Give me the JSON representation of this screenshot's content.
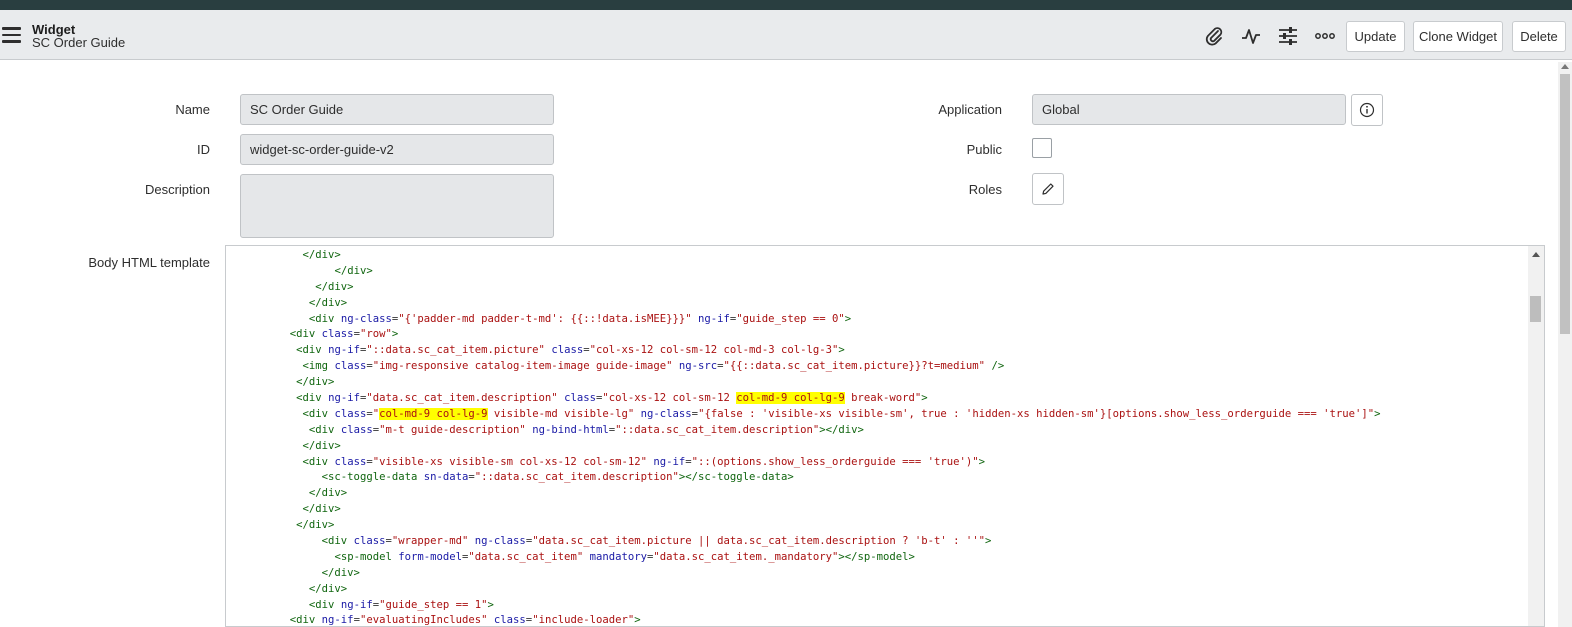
{
  "header": {
    "title": "Widget",
    "subtitle": "SC Order Guide",
    "icons": [
      "paperclip-icon",
      "activity-icon",
      "sliders-icon",
      "more-icon"
    ],
    "buttons": {
      "update": "Update",
      "clone": "Clone Widget",
      "delete": "Delete"
    }
  },
  "form": {
    "name": {
      "label": "Name",
      "value": "SC Order Guide"
    },
    "id": {
      "label": "ID",
      "value": "widget-sc-order-guide-v2"
    },
    "description": {
      "label": "Description",
      "value": ""
    },
    "application": {
      "label": "Application",
      "value": "Global"
    },
    "public": {
      "label": "Public",
      "checked": false
    },
    "roles": {
      "label": "Roles"
    },
    "body_html": {
      "label": "Body HTML template"
    }
  },
  "code_lines": [
    {
      "indent": "            ",
      "segs": [
        [
          "tg",
          "</div>"
        ]
      ]
    },
    {
      "indent": "                 ",
      "segs": [
        [
          "tg",
          "</div>"
        ]
      ]
    },
    {
      "indent": "              ",
      "segs": [
        [
          "tg",
          "</div>"
        ]
      ]
    },
    {
      "indent": "             ",
      "segs": [
        [
          "tg",
          "</div>"
        ]
      ]
    },
    {
      "indent": "             ",
      "segs": [
        [
          "tg",
          "<div "
        ],
        [
          "at",
          "ng-class"
        ],
        [
          "pl",
          "="
        ],
        [
          "st",
          "\"{'padder-md padder-t-md': {{::!data.isMEE}}}\""
        ],
        [
          "pl",
          " "
        ],
        [
          "at",
          "ng-if"
        ],
        [
          "pl",
          "="
        ],
        [
          "st",
          "\"guide_step == 0\""
        ],
        [
          "tg",
          ">"
        ]
      ]
    },
    {
      "indent": "          ",
      "segs": [
        [
          "tg",
          "<div "
        ],
        [
          "at",
          "class"
        ],
        [
          "pl",
          "="
        ],
        [
          "st",
          "\"row\""
        ],
        [
          "tg",
          ">"
        ]
      ]
    },
    {
      "indent": "           ",
      "segs": [
        [
          "tg",
          "<div "
        ],
        [
          "at",
          "ng-if"
        ],
        [
          "pl",
          "="
        ],
        [
          "st",
          "\"::data.sc_cat_item.picture\""
        ],
        [
          "pl",
          " "
        ],
        [
          "at",
          "class"
        ],
        [
          "pl",
          "="
        ],
        [
          "st",
          "\"col-xs-12 col-sm-12 col-md-3 col-lg-3\""
        ],
        [
          "tg",
          ">"
        ]
      ]
    },
    {
      "indent": "            ",
      "segs": [
        [
          "tg",
          "<img "
        ],
        [
          "at",
          "class"
        ],
        [
          "pl",
          "="
        ],
        [
          "st",
          "\"img-responsive catalog-item-image guide-image\""
        ],
        [
          "pl",
          " "
        ],
        [
          "at",
          "ng-src"
        ],
        [
          "pl",
          "="
        ],
        [
          "st",
          "\"{{::data.sc_cat_item.picture}}?t=medium\""
        ],
        [
          "pl",
          " "
        ],
        [
          "tg",
          "/>"
        ]
      ]
    },
    {
      "indent": "           ",
      "segs": [
        [
          "tg",
          "</div>"
        ]
      ]
    },
    {
      "indent": "           ",
      "segs": [
        [
          "tg",
          "<div "
        ],
        [
          "at",
          "ng-if"
        ],
        [
          "pl",
          "="
        ],
        [
          "st",
          "\"data.sc_cat_item.description\""
        ],
        [
          "pl",
          " "
        ],
        [
          "at",
          "class"
        ],
        [
          "pl",
          "="
        ],
        [
          "st",
          "\"col-xs-12 col-sm-12 "
        ],
        [
          "sthl",
          "col-md-9 col-lg-9"
        ],
        [
          "st",
          " break-word\""
        ],
        [
          "tg",
          ">"
        ]
      ]
    },
    {
      "indent": "            ",
      "segs": [
        [
          "tg",
          "<div "
        ],
        [
          "at",
          "class"
        ],
        [
          "pl",
          "="
        ],
        [
          "st",
          "\""
        ],
        [
          "sthl",
          "col-md-9 col-lg-9"
        ],
        [
          "st",
          " visible-md visible-lg\""
        ],
        [
          "pl",
          " "
        ],
        [
          "at",
          "ng-class"
        ],
        [
          "pl",
          "="
        ],
        [
          "st",
          "\"{false : 'visible-xs visible-sm', true : 'hidden-xs hidden-sm'}[options.show_less_orderguide === 'true']\""
        ],
        [
          "tg",
          ">"
        ]
      ]
    },
    {
      "indent": "             ",
      "segs": [
        [
          "tg",
          "<div "
        ],
        [
          "at",
          "class"
        ],
        [
          "pl",
          "="
        ],
        [
          "st",
          "\"m-t guide-description\""
        ],
        [
          "pl",
          " "
        ],
        [
          "at",
          "ng-bind-html"
        ],
        [
          "pl",
          "="
        ],
        [
          "st",
          "\"::data.sc_cat_item.description\""
        ],
        [
          "tg",
          "></div>"
        ]
      ]
    },
    {
      "indent": "            ",
      "segs": [
        [
          "tg",
          "</div>"
        ]
      ]
    },
    {
      "indent": "            ",
      "segs": [
        [
          "tg",
          "<div "
        ],
        [
          "at",
          "class"
        ],
        [
          "pl",
          "="
        ],
        [
          "st",
          "\"visible-xs visible-sm col-xs-12 col-sm-12\""
        ],
        [
          "pl",
          " "
        ],
        [
          "at",
          "ng-if"
        ],
        [
          "pl",
          "="
        ],
        [
          "st",
          "\"::(options.show_less_orderguide === 'true')\""
        ],
        [
          "tg",
          ">"
        ]
      ]
    },
    {
      "indent": "               ",
      "segs": [
        [
          "tg",
          "<sc-toggle-data "
        ],
        [
          "at",
          "sn-data"
        ],
        [
          "pl",
          "="
        ],
        [
          "st",
          "\"::data.sc_cat_item.description\""
        ],
        [
          "tg",
          "></sc-toggle-data>"
        ]
      ]
    },
    {
      "indent": "             ",
      "segs": [
        [
          "tg",
          "</div>"
        ]
      ]
    },
    {
      "indent": "            ",
      "segs": [
        [
          "tg",
          "</div>"
        ]
      ]
    },
    {
      "indent": "           ",
      "segs": [
        [
          "tg",
          "</div>"
        ]
      ]
    },
    {
      "indent": "               ",
      "segs": [
        [
          "tg",
          "<div "
        ],
        [
          "at",
          "class"
        ],
        [
          "pl",
          "="
        ],
        [
          "st",
          "\"wrapper-md\""
        ],
        [
          "pl",
          " "
        ],
        [
          "at",
          "ng-class"
        ],
        [
          "pl",
          "="
        ],
        [
          "st",
          "\"data.sc_cat_item.picture || data.sc_cat_item.description ? 'b-t' : ''\""
        ],
        [
          "tg",
          ">"
        ]
      ]
    },
    {
      "indent": "                 ",
      "segs": [
        [
          "tg",
          "<sp-model "
        ],
        [
          "at",
          "form-model"
        ],
        [
          "pl",
          "="
        ],
        [
          "st",
          "\"data.sc_cat_item\""
        ],
        [
          "pl",
          " "
        ],
        [
          "at",
          "mandatory"
        ],
        [
          "pl",
          "="
        ],
        [
          "st",
          "\"data.sc_cat_item._mandatory\""
        ],
        [
          "tg",
          "></sp-model>"
        ]
      ]
    },
    {
      "indent": "               ",
      "segs": [
        [
          "tg",
          "</div>"
        ]
      ]
    },
    {
      "indent": "             ",
      "segs": [
        [
          "tg",
          "</div>"
        ]
      ]
    },
    {
      "indent": "             ",
      "segs": [
        [
          "tg",
          "<div "
        ],
        [
          "at",
          "ng-if"
        ],
        [
          "pl",
          "="
        ],
        [
          "st",
          "\"guide_step == 1\""
        ],
        [
          "tg",
          ">"
        ]
      ]
    },
    {
      "indent": "          ",
      "segs": [
        [
          "tg",
          "<div "
        ],
        [
          "at",
          "ng-if"
        ],
        [
          "pl",
          "="
        ],
        [
          "st",
          "\"evaluatingIncludes\""
        ],
        [
          "pl",
          " "
        ],
        [
          "at",
          "class"
        ],
        [
          "pl",
          "="
        ],
        [
          "st",
          "\"include-loader\""
        ],
        [
          "tg",
          ">"
        ]
      ]
    }
  ]
}
